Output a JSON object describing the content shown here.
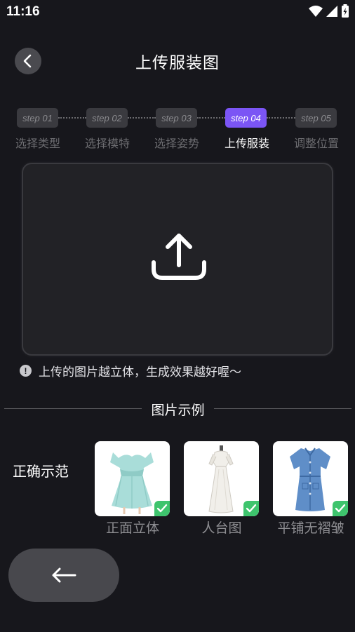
{
  "status_bar": {
    "time": "11:16"
  },
  "header": {
    "title": "上传服装图"
  },
  "steps": [
    {
      "badge": "step 01",
      "label": "选择类型",
      "active": false
    },
    {
      "badge": "step 02",
      "label": "选择模特",
      "active": false
    },
    {
      "badge": "step 03",
      "label": "选择姿势",
      "active": false
    },
    {
      "badge": "step 04",
      "label": "上传服装",
      "active": true
    },
    {
      "badge": "step 05",
      "label": "调整位置",
      "active": false
    }
  ],
  "hint": {
    "icon": "!",
    "text": "上传的图片越立体，生成效果越好喔～"
  },
  "examples_section": {
    "title": "图片示例",
    "correct_label": "正确示范",
    "items": [
      {
        "label": "正面立体",
        "icon": "teal-ruffle-dress"
      },
      {
        "label": "人台图",
        "icon": "white-gown-on-mannequin"
      },
      {
        "label": "平铺无褶皱",
        "icon": "denim-shirt-dress"
      }
    ]
  },
  "colors": {
    "background": "#17171c",
    "accent": "#7b55f5",
    "check": "#3ec46d"
  }
}
